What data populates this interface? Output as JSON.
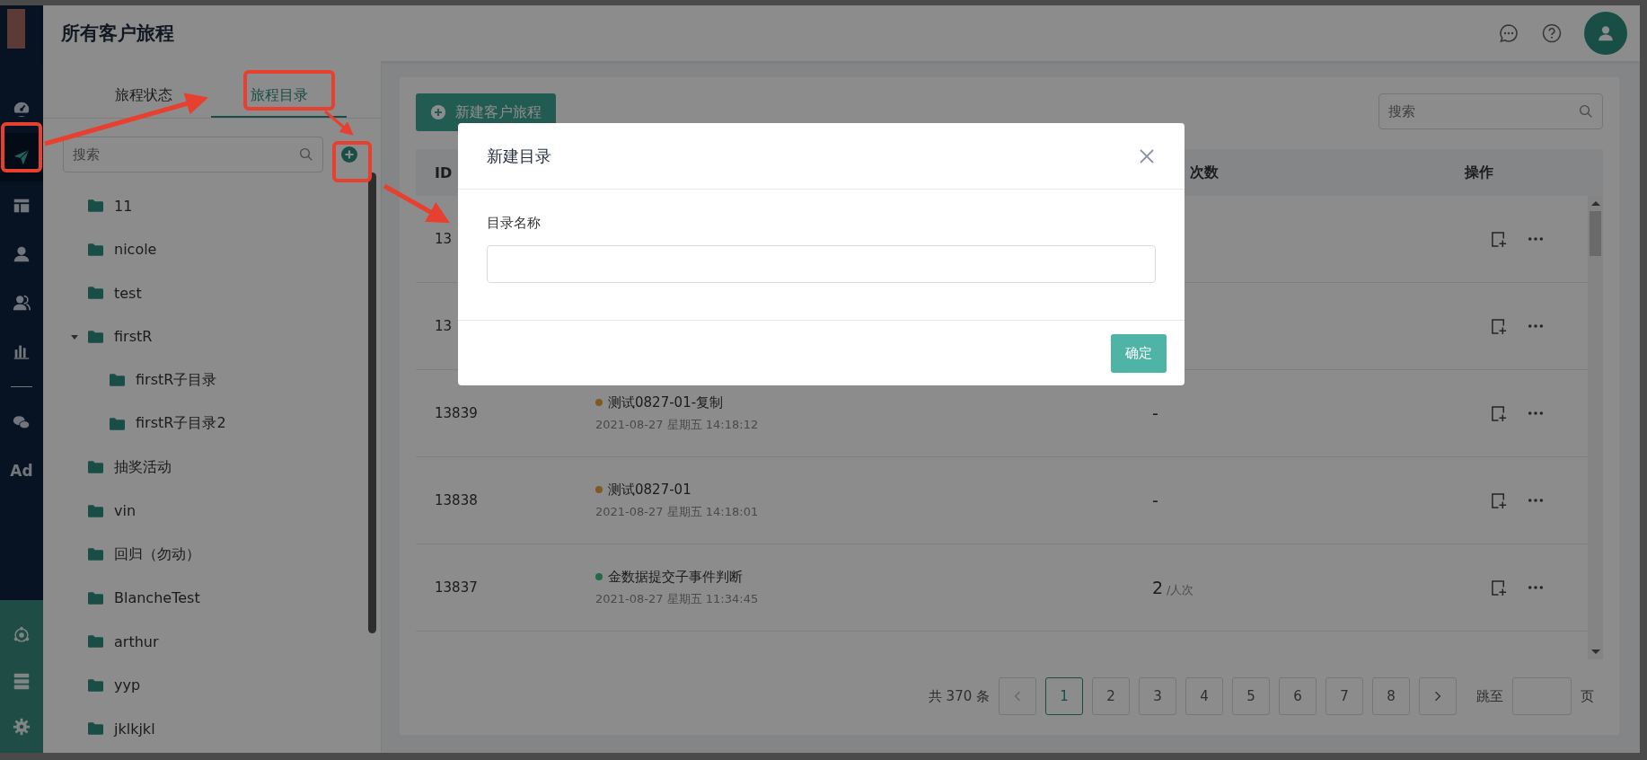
{
  "nav": {
    "items": [
      {
        "kind": "gauge",
        "selected": false
      },
      {
        "kind": "send",
        "selected": true
      },
      {
        "kind": "layout",
        "selected": false
      },
      {
        "kind": "user",
        "selected": false
      },
      {
        "kind": "users",
        "selected": false
      },
      {
        "kind": "bars",
        "selected": false
      },
      {
        "kind": "divider"
      },
      {
        "kind": "chat",
        "selected": false
      },
      {
        "kind": "text",
        "label": "Ad",
        "selected": false
      }
    ],
    "bottom_items": [
      {
        "kind": "hub"
      },
      {
        "kind": "server"
      },
      {
        "kind": "gear"
      }
    ]
  },
  "header": {
    "title": "所有客户旅程"
  },
  "folder_panel": {
    "tabs": [
      {
        "label": "旅程状态",
        "selected": false
      },
      {
        "label": "旅程目录",
        "selected": true
      }
    ],
    "search": {
      "placeholder": "搜索"
    },
    "tree": [
      {
        "label": "11"
      },
      {
        "label": "nicole"
      },
      {
        "label": "test"
      },
      {
        "label": "firstR",
        "expanded": true,
        "children": [
          {
            "label": "firstR子目录"
          },
          {
            "label": "firstR子目录2"
          }
        ]
      },
      {
        "label": "抽奖活动"
      },
      {
        "label": "vin"
      },
      {
        "label": "回归（勿动）"
      },
      {
        "label": "BlancheTest"
      },
      {
        "label": "arthur"
      },
      {
        "label": "yyp"
      },
      {
        "label": "jklkjkl"
      }
    ]
  },
  "journeys": {
    "new_button": "新建客户旅程",
    "search": {
      "placeholder": "搜索"
    },
    "table": {
      "columns": [
        "ID",
        "次数",
        "操作"
      ],
      "rows": [
        {
          "id": "13"
        },
        {
          "id": "13"
        },
        {
          "id": "13839",
          "name": "测试0827-01-复制",
          "color": "#805a20",
          "time": "2021-08-27 星期五 14:18:12",
          "count": "-"
        },
        {
          "id": "13838",
          "name": "测试0827-01",
          "color": "#805a20",
          "time": "2021-08-27 星期五 14:18:01",
          "count": "-"
        },
        {
          "id": "13837",
          "name": "金数据提交子事件判断",
          "color": "#236943",
          "time": "2021-08-27 星期五 11:34:45",
          "count": "2",
          "count_unit": "/人次"
        }
      ]
    },
    "pagination": {
      "total": "共 370 条",
      "pages": [
        {
          "label": "1",
          "selected": true
        },
        {
          "label": "2",
          "selected": false
        },
        {
          "label": "3",
          "selected": false
        },
        {
          "label": "4",
          "selected": false
        },
        {
          "label": "5",
          "selected": false
        },
        {
          "label": "6",
          "selected": false
        },
        {
          "label": "7",
          "selected": false
        },
        {
          "label": "8",
          "selected": false
        }
      ],
      "jump_label": "跳至",
      "page_unit": "页"
    }
  },
  "dialog": {
    "title": "新建目录",
    "field_label": "目录名称",
    "confirm": "确定"
  }
}
